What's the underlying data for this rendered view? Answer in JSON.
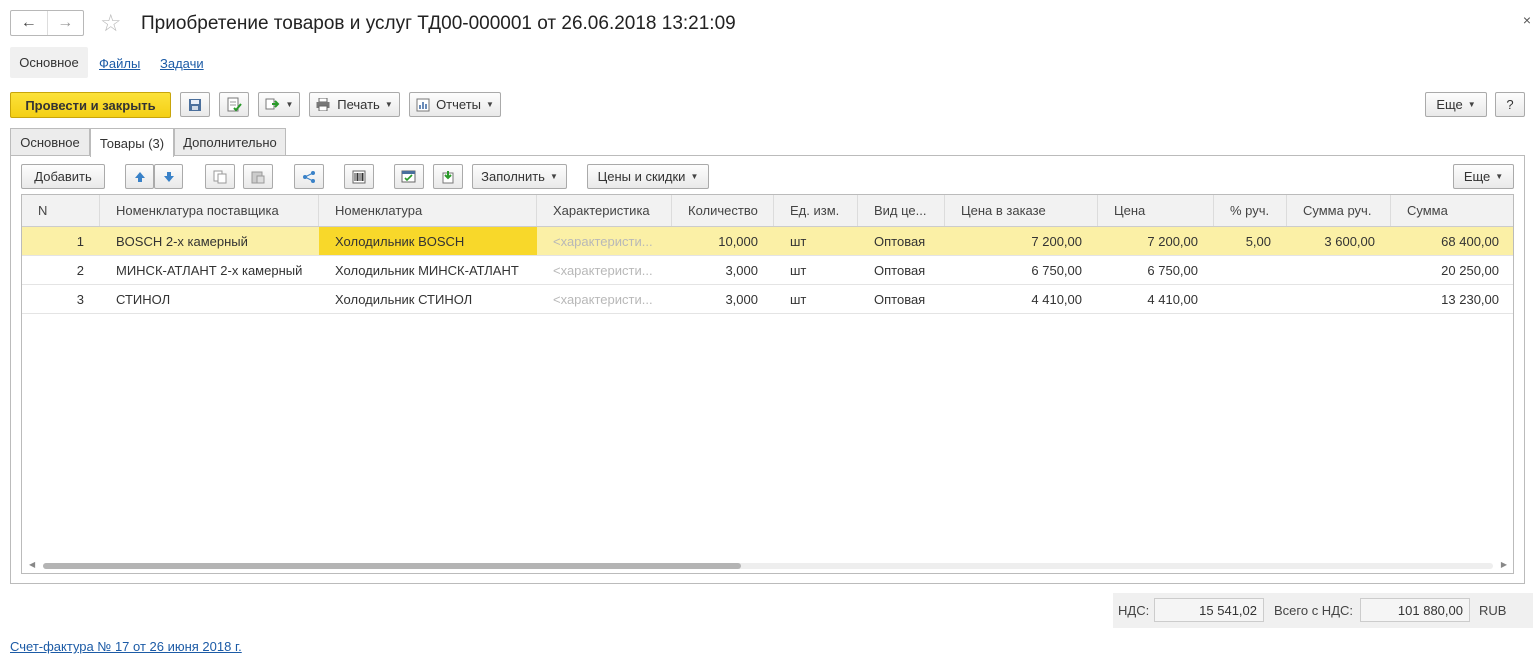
{
  "header": {
    "back_icon": "←",
    "forward_icon": "→",
    "star_icon": "☆",
    "title": "Приобретение товаров и услуг ТД00-000001 от 26.06.2018 13:21:09",
    "close_icon": "×"
  },
  "sections": {
    "main": "Основное",
    "files": "Файлы",
    "tasks": "Задачи"
  },
  "toolbar": {
    "post_close": "Провести и закрыть",
    "print": "Печать",
    "reports": "Отчеты",
    "more": "Еще",
    "help": "?"
  },
  "tabs": {
    "main": "Основное",
    "goods": "Товары (3)",
    "extra": "Дополнительно"
  },
  "table_toolbar": {
    "add": "Добавить",
    "fill": "Заполнить",
    "prices": "Цены и скидки",
    "more": "Еще"
  },
  "table": {
    "columns": [
      "N",
      "Номенклатура поставщика",
      "Номенклатура",
      "Характеристика",
      "Количество",
      "Ед. изм.",
      "Вид це...",
      "Цена в заказе",
      "Цена",
      "% руч.",
      "Сумма руч.",
      "Сумма"
    ],
    "rows": [
      {
        "n": "1",
        "supplier_item": "BOSCH 2-х камерный",
        "item": "Холодильник BOSCH",
        "characteristic": "<характеристи...",
        "qty": "10,000",
        "unit": "шт",
        "price_type": "Оптовая",
        "order_price": "7 200,00",
        "price": "7 200,00",
        "manual_pct": "5,00",
        "manual_sum": "3 600,00",
        "sum": "68 400,00"
      },
      {
        "n": "2",
        "supplier_item": "МИНСК-АТЛАНТ 2-х камерный",
        "item": "Холодильник МИНСК-АТЛАНТ",
        "characteristic": "<характеристи...",
        "qty": "3,000",
        "unit": "шт",
        "price_type": "Оптовая",
        "order_price": "6 750,00",
        "price": "6 750,00",
        "manual_pct": "",
        "manual_sum": "",
        "sum": "20 250,00"
      },
      {
        "n": "3",
        "supplier_item": "СТИНОЛ",
        "item": "Холодильник СТИНОЛ",
        "characteristic": "<характеристи...",
        "qty": "3,000",
        "unit": "шт",
        "price_type": "Оптовая",
        "order_price": "4 410,00",
        "price": "4 410,00",
        "manual_pct": "",
        "manual_sum": "",
        "sum": "13 230,00"
      }
    ]
  },
  "totals": {
    "vat_label": "НДС:",
    "vat_value": "15 541,02",
    "total_label": "Всего с НДС:",
    "total_value": "101 880,00",
    "currency": "RUB"
  },
  "invoice_link": "Счет-фактура  № 17 от 26 июня 2018 г.",
  "colors": {
    "primary_button": "#f4cf15",
    "selected_row": "#fbf0a6",
    "current_cell": "#f8d82a",
    "link": "#1c5ba6"
  }
}
